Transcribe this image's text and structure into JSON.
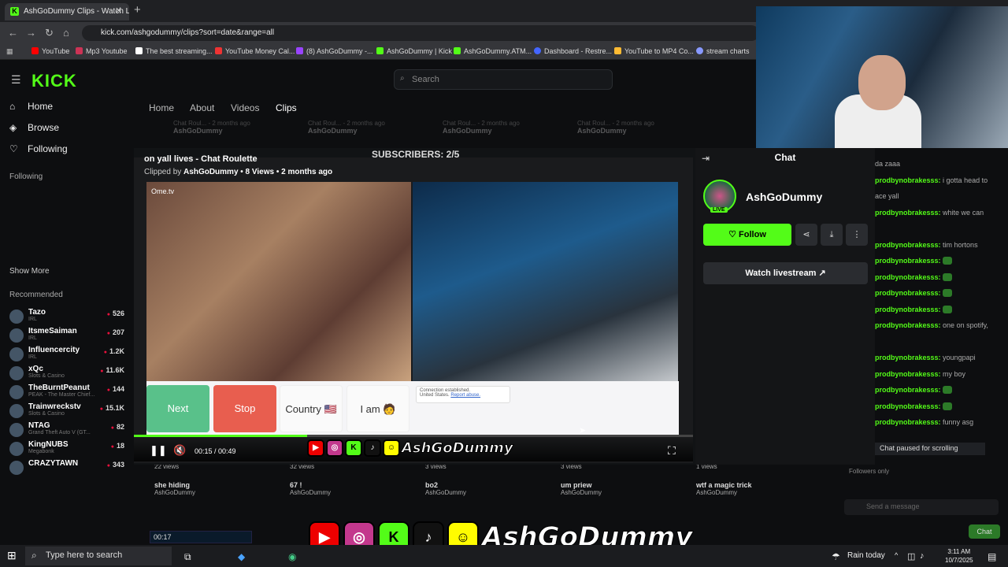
{
  "browser": {
    "tab_title": "AshGoDummy Clips - Watch Li",
    "url": "kick.com/ashgodummy/clips?sort=date&range=all",
    "bookmarks": [
      "YouTube",
      "Mp3 Youtube",
      "The best streaming...",
      "YouTube Money Cal...",
      "(8) AshGoDummy -...",
      "AshGoDummy | Kick",
      "AshGoDummy.ATM...",
      "Dashboard - Restre...",
      "YouTube to MP4 Co...",
      "stream charts"
    ]
  },
  "site": {
    "logo": "KICK",
    "search_placeholder": "Search",
    "nav": {
      "home": "Home",
      "browse": "Browse",
      "following": "Following"
    },
    "following_label": "Following",
    "show_more": "Show More",
    "recommended_label": "Recommended",
    "recommended": [
      {
        "name": "Tazo",
        "cat": "IRL",
        "count": "526"
      },
      {
        "name": "ItsmeSaiman",
        "cat": "IRL",
        "count": "207"
      },
      {
        "name": "Influencercity",
        "cat": "IRL",
        "count": "1.2K"
      },
      {
        "name": "xQc",
        "cat": "Slots & Casino",
        "count": "11.6K"
      },
      {
        "name": "TheBurntPeanut",
        "cat": "PEAK - The Master Chief...",
        "count": "144"
      },
      {
        "name": "Trainwreckstv",
        "cat": "Slots & Casino",
        "count": "15.1K"
      },
      {
        "name": "NTAG",
        "cat": "Grand Theft Auto V (GT...",
        "count": "82"
      },
      {
        "name": "KingNUBS",
        "cat": "Megabonk",
        "count": "18"
      },
      {
        "name": "CRAZYTAWN",
        "cat": "",
        "count": "343"
      }
    ],
    "channel_tabs": [
      "Home",
      "About",
      "Videos",
      "Clips"
    ],
    "clip_row_top": {
      "title": "Chat Roul...",
      "age": "2 months ago",
      "author": "AshGoDummy"
    },
    "clip_row_bottom": [
      {
        "views": "22 views",
        "title": "she hiding",
        "author": "AshGoDummy"
      },
      {
        "views": "32 views",
        "title": "67 !",
        "author": "AshGoDummy"
      },
      {
        "views": "3 views",
        "title": "bo2",
        "author": "AshGoDummy"
      },
      {
        "views": "3 views",
        "title": "um priew",
        "author": "AshGoDummy"
      },
      {
        "views": "1 views",
        "title": "wtf a magic trick",
        "author": "AshGoDummy"
      }
    ],
    "subscribers": "SUBSCRIBERS: 2/5"
  },
  "clip": {
    "title": "on yall lives - Chat Roulette",
    "clipped_by_prefix": "Clipped by",
    "clipped_by": "AshGoDummy",
    "meta": "• 8 Views • 2 months ago",
    "time": "00:15 / 00:49",
    "progress": 0.31,
    "ome_logo": "Ome.tv",
    "ome_buttons": [
      "Next",
      "Stop",
      "Country 🇺🇸",
      "I am 🧑"
    ],
    "connection": "Connection established.",
    "connection_loc": "United States.",
    "report": "Report abuse.",
    "overlay_name": "AshGoDummy"
  },
  "chat": {
    "header": "Chat",
    "channel": "AshGoDummy",
    "live": "LIVE",
    "follow": "Follow",
    "watch": "Watch livestream",
    "messages": [
      {
        "user": "",
        "text": "da zaaa"
      },
      {
        "user": "prodbynobrakesss:",
        "text": "i gotta head to"
      },
      {
        "user": "",
        "text": "ace yall"
      },
      {
        "user": "prodbynobrakesss:",
        "text": "white we can"
      },
      {
        "user": "",
        "text": ""
      },
      {
        "user": "prodbynobrakesss:",
        "text": "tim hortons"
      },
      {
        "user": "prodbynobrakesss:",
        "text": ""
      },
      {
        "user": "prodbynobrakesss:",
        "text": ""
      },
      {
        "user": "prodbynobrakesss:",
        "text": ""
      },
      {
        "user": "prodbynobrakesss:",
        "text": ""
      },
      {
        "user": "prodbynobrakesss:",
        "text": "one on spotify,"
      },
      {
        "user": "",
        "text": ""
      },
      {
        "user": "prodbynobrakesss:",
        "text": "youngpapi"
      },
      {
        "user": "prodbynobrakesss:",
        "text": "my boy"
      },
      {
        "user": "prodbynobrakesss:",
        "text": ""
      },
      {
        "user": "prodbynobrakesss:",
        "text": ""
      },
      {
        "user": "prodbynobrakesss:",
        "text": "funny asg"
      }
    ],
    "paused": "Chat paused for scrolling",
    "followers_only": "Followers only",
    "send_placeholder": "Send a message",
    "send_button": "Chat"
  },
  "overlay": {
    "name": "AshGoDummy",
    "timestamp": "00:17"
  },
  "taskbar": {
    "search": "Type here to search",
    "weather": "Rain today",
    "time": "3:11 AM",
    "date": "10/7/2025"
  },
  "colors": {
    "kick_green": "#53fc18"
  }
}
